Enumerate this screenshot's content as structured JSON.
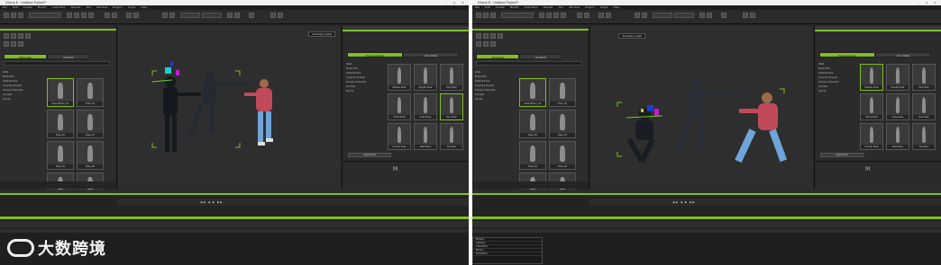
{
  "colors": {
    "accent": "#7fbf1f",
    "bg": "#262626"
  },
  "watermark": {
    "text": "大数跨境"
  },
  "left": {
    "title": "iClone 8 - Untitled Project*",
    "menu": [
      "File",
      "Edit",
      "Create",
      "Modify",
      "Animation",
      "Render",
      "Sim",
      "Window",
      "Plugins",
      "Script",
      "Help"
    ],
    "tabs": [
      "Template",
      "Custom"
    ],
    "viewport_button": "Auxiliary Light",
    "right_tabs": [
      "Pose Content",
      "Link Data"
    ],
    "tree": [
      "Walk",
      "Motion3D",
      "Default Pose",
      "Inverted Kinesis",
      "Kinesis Character",
      "Combat",
      "Sports"
    ],
    "thumbs": [
      "Pose Motion_01",
      "Pose_01",
      "Pose_02",
      "Pose_03",
      "Pose_04",
      "Pose_05",
      "Pose_06",
      "Pose_07"
    ],
    "pose_grid": [
      "Mambo Pose",
      "Kungfu Pose",
      "Kick Pose",
      "Shoot Pose",
      "Jump Pose",
      "Run Pose",
      "Crouch Pose",
      "Rest Pose",
      "Fly Pose"
    ],
    "action_btn": "Apply Pose"
  },
  "right": {
    "title": "iClone 8 - Untitled Project*",
    "menu": [
      "File",
      "Edit",
      "Create",
      "Modify",
      "Animation",
      "Render",
      "Sim",
      "Window",
      "Plugins",
      "Script",
      "Help"
    ],
    "tabs": [
      "Template",
      "Custom"
    ],
    "viewport_button": "Auxiliary Light",
    "right_tabs": [
      "Pose Content",
      "Link Data"
    ],
    "tree": [
      "Walk",
      "Motion3D",
      "Default Pose",
      "Inverted Kinesis",
      "Kinesis Character",
      "Combat",
      "Sports"
    ],
    "thumbs": [
      "Pose Motion_01",
      "Pose_01",
      "Pose_02",
      "Pose_03",
      "Pose_04",
      "Pose_05",
      "Pose_06",
      "Pose_07"
    ],
    "pose_grid": [
      "Mambo Pose",
      "Kungfu Pose",
      "Kick Pose",
      "Shoot Pose",
      "Jump Pose",
      "Run Pose",
      "Crouch Pose",
      "Rest Pose",
      "Fly Pose"
    ],
    "timeline_rows": [
      "Project",
      "Camera",
      "Character",
      "Motion",
      "Transform"
    ],
    "action_btn": "Apply Pose"
  }
}
